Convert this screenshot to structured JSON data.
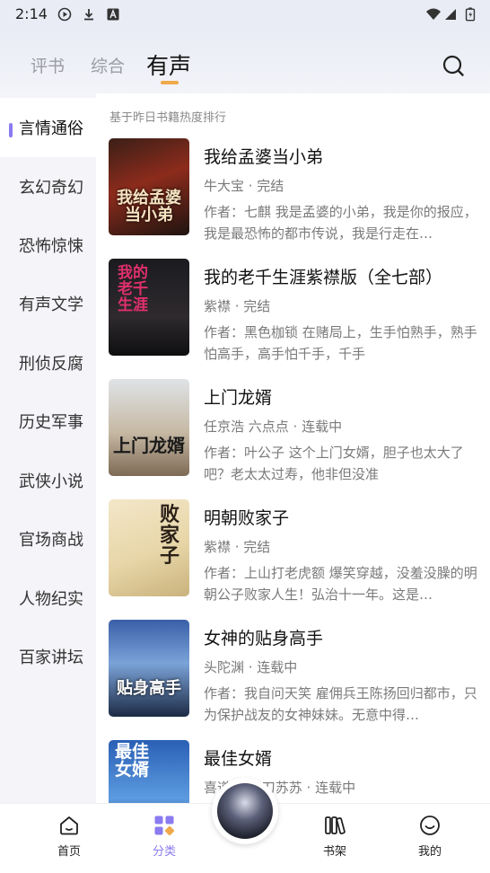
{
  "status_bar": {
    "time": "2:14",
    "icons": [
      "play-circle-icon",
      "download-icon",
      "font-a-icon",
      "wifi-icon",
      "signal-icon",
      "battery-icon"
    ]
  },
  "header": {
    "tabs": [
      {
        "label": "评书",
        "active": false
      },
      {
        "label": "综合",
        "active": false
      },
      {
        "label": "有声",
        "active": true
      }
    ],
    "search_icon": "search-icon",
    "accent_color": "#f0a94a"
  },
  "sidebar": {
    "active_color": "#8a7bf0",
    "items": [
      {
        "label": "言情通俗",
        "active": true
      },
      {
        "label": "玄幻奇幻",
        "active": false
      },
      {
        "label": "恐怖惊悚",
        "active": false
      },
      {
        "label": "有声文学",
        "active": false
      },
      {
        "label": "刑侦反腐",
        "active": false
      },
      {
        "label": "历史军事",
        "active": false
      },
      {
        "label": "武侠小说",
        "active": false
      },
      {
        "label": "官场商战",
        "active": false
      },
      {
        "label": "人物纪实",
        "active": false
      },
      {
        "label": "百家讲坛",
        "active": false
      }
    ]
  },
  "content": {
    "caption": "基于昨日书籍热度排行",
    "books": [
      {
        "title": "我给孟婆当小弟",
        "meta": "牛大宝 · 完结",
        "desc": "作者：七麒 我是孟婆的小弟，我是你的报应，我是最恐怖的都市传说，我是行走在…",
        "cover_text": "我给孟婆当小弟"
      },
      {
        "title": "我的老千生涯紫襟版（全七部）",
        "meta": "紫襟 · 完结",
        "desc": "作者：黑色枷锁 在赌局上，生手怕熟手，熟手怕高手，高手怕千手，千手",
        "cover_text": "我的老千生涯"
      },
      {
        "title": "上门龙婿",
        "meta": "任京浩 六点点 · 连载中",
        "desc": "作者：叶公子 这个上门女婿，胆子也太大了吧？老太太过寿，他非但没准",
        "cover_text": "上门龙婿"
      },
      {
        "title": "明朝败家子",
        "meta": "紫襟 · 完结",
        "desc": "作者：上山打老虎额 爆笑穿越，没羞没臊的明朝公子败家人生！弘治十一年。这是…",
        "cover_text": "败家子"
      },
      {
        "title": "女神的贴身高手",
        "meta": "头陀渊 · 连载中",
        "desc": "作者：我自问天笑 雇佣兵王陈扬回归都市，只为保护战友的女神妹妹。无意中得…",
        "cover_text": "贴身高手"
      },
      {
        "title": "最佳女婿",
        "meta": "喜道… 一刀苏苏 · 连载中",
        "desc": "",
        "cover_text": "最佳女婿"
      }
    ]
  },
  "bottom_nav": {
    "items": [
      {
        "label": "首页",
        "icon": "home-icon",
        "active": false
      },
      {
        "label": "分类",
        "icon": "category-grid-icon",
        "active": true
      },
      {
        "label": "书架",
        "icon": "bookshelf-icon",
        "active": false
      },
      {
        "label": "我的",
        "icon": "profile-smile-icon",
        "active": false
      }
    ],
    "center_icon": "now-playing-disc-icon"
  }
}
